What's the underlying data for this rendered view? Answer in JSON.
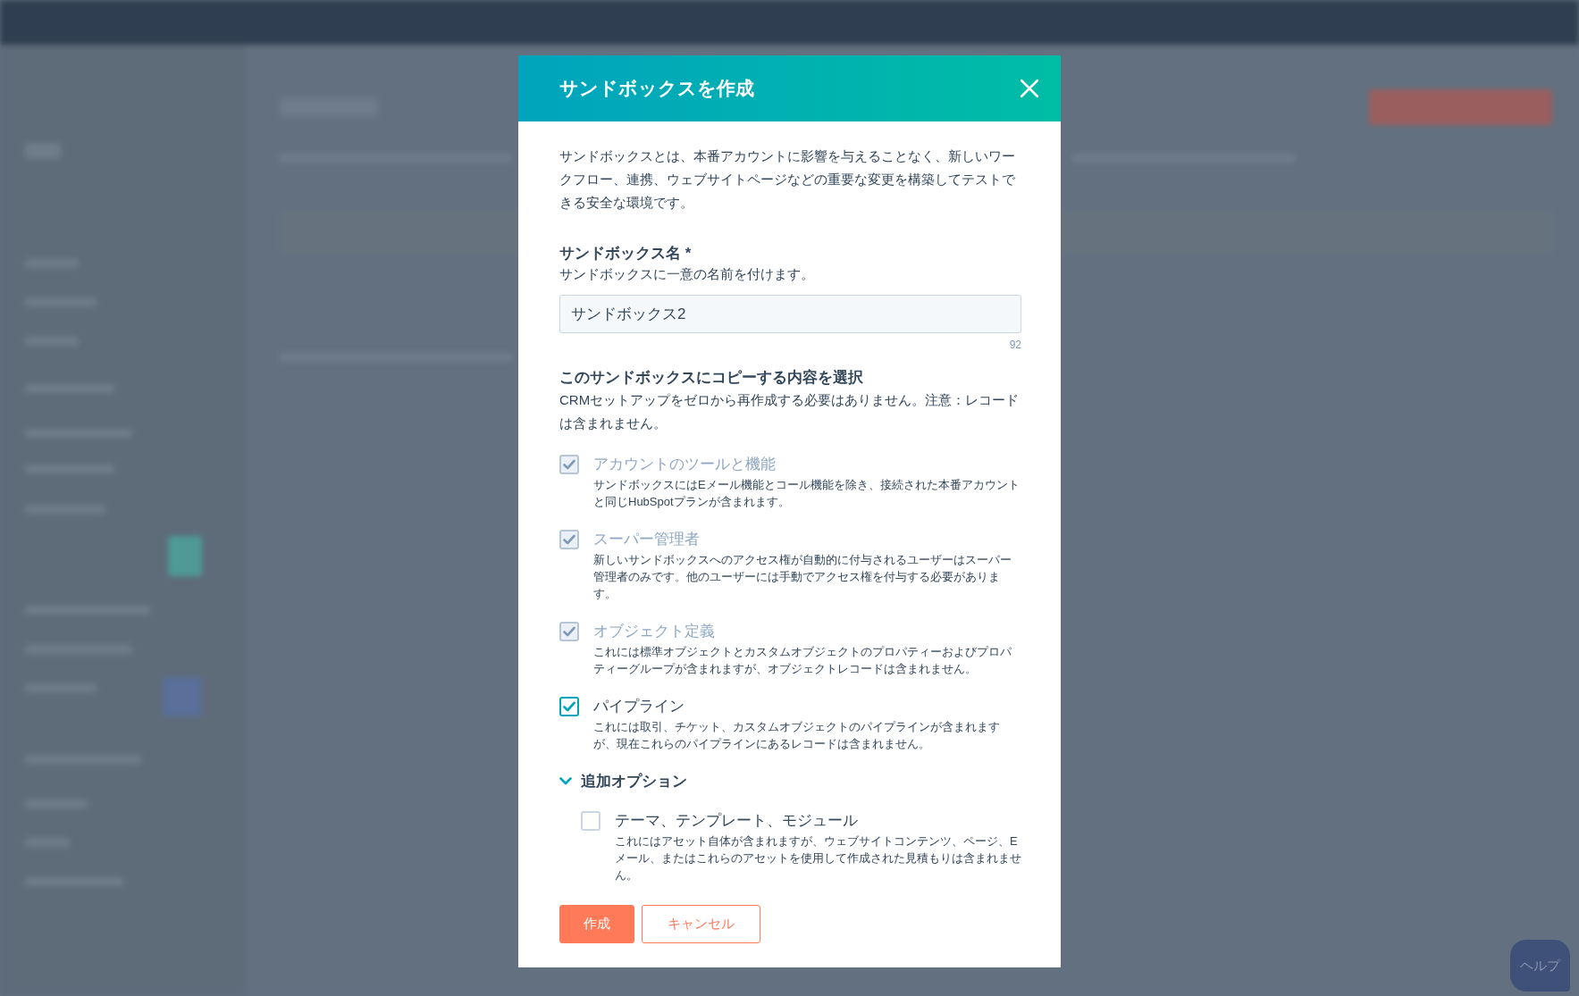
{
  "dialog": {
    "title": "サンドボックスを作成",
    "intro": "サンドボックスとは、本番アカウントに影響を与えることなく、新しいワークフロー、連携、ウェブサイトページなどの重要な変更を構築してテストできる安全な環境です。",
    "name_field": {
      "label": "サンドボックス名 *",
      "help": "サンドボックスに一意の名前を付けます。",
      "value": "サンドボックス2",
      "counter": "92"
    },
    "copy_section": {
      "title": "このサンドボックスにコピーする内容を選択",
      "description": "CRMセットアップをゼロから再作成する必要はありません。注意：レコードは含まれません。",
      "options": [
        {
          "label": "アカウントのツールと機能",
          "description": "サンドボックスにはEメール機能とコール機能を除き、接続された本番アカウントと同じHubSpotプランが含まれます。",
          "checked": true,
          "disabled": true
        },
        {
          "label": "スーパー管理者",
          "description": "新しいサンドボックスへのアクセス権が自動的に付与されるユーザーはスーパー管理者のみです。他のユーザーには手動でアクセス権を付与する必要があります。",
          "checked": true,
          "disabled": true
        },
        {
          "label": "オブジェクト定義",
          "description": "これには標準オブジェクトとカスタムオブジェクトのプロパティーおよびプロパティーグループが含まれますが、オブジェクトレコードは含まれません。",
          "checked": true,
          "disabled": true
        },
        {
          "label": "パイプライン",
          "description": "これには取引、チケット、カスタムオブジェクトのパイプラインが含まれますが、現在これらのパイプラインにあるレコードは含まれません。",
          "checked": true,
          "disabled": false
        }
      ]
    },
    "additional_options": {
      "label": "追加オプション",
      "expanded": true,
      "options": [
        {
          "label": "テーマ、テンプレート、モジュール",
          "description": "これにはアセット自体が含まれますが、ウェブサイトコンテンツ、ページ、Eメール、またはこれらのアセットを使用して作成された見積もりは含まれません。",
          "checked": false,
          "disabled": false
        }
      ]
    },
    "buttons": [
      {
        "label": "作成",
        "kind": "primary"
      },
      {
        "label": "キャンセル",
        "kind": "secondary"
      }
    ]
  },
  "help_button": {
    "label": "ヘルプ"
  }
}
